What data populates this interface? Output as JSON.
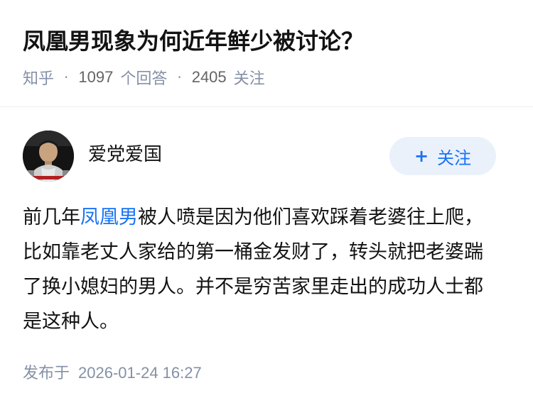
{
  "question": {
    "title": "凤凰男现象为何近年鲜少被讨论？",
    "source": "知乎",
    "answers_count": "1097",
    "answers_label": "个回答",
    "followers_count": "2405",
    "followers_label": "关注",
    "separator": "·"
  },
  "author": {
    "name": "爱党爱国",
    "avatar_icon": "avatar-photo"
  },
  "follow_button": {
    "plus": "+",
    "label": "关注"
  },
  "answer": {
    "prefix": "前几年",
    "link_text": "凤凰男",
    "text": "被人喷是因为他们喜欢踩着老婆往上爬，比如靠老丈人家给的第一桶金发财了，转头就把老婆踹了换小媳妇的男人。并不是穷苦家里走出的成功人士都是这种人。"
  },
  "published": {
    "label": "发布于",
    "time": "2026-01-24 16:27"
  },
  "colors": {
    "link": "#1772f6",
    "meta": "#8590a6",
    "follow_bg": "#eaf1fb"
  }
}
